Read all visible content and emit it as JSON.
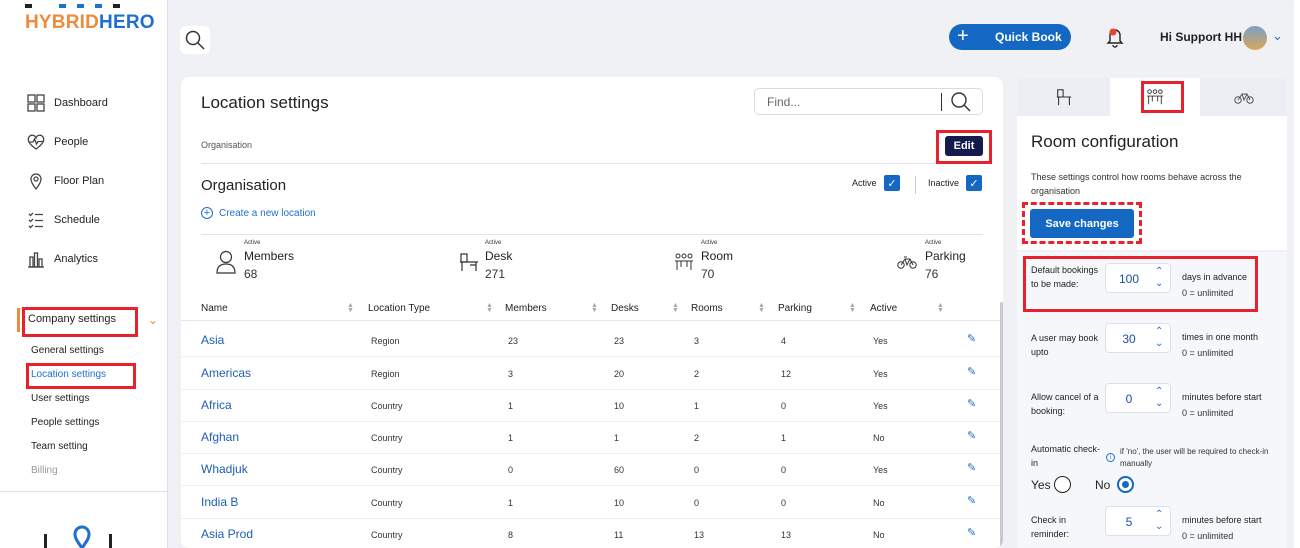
{
  "app": {
    "logo_part1": "HYBRID",
    "logo_part2": "HERO",
    "brand_orange": "#f08a3c",
    "brand_blue": "#1e6fd0"
  },
  "sidebar": {
    "items": [
      {
        "label": "Dashboard",
        "icon": "dashboard-icon"
      },
      {
        "label": "People",
        "icon": "heart-pulse-icon"
      },
      {
        "label": "Floor Plan",
        "icon": "map-pin-icon"
      },
      {
        "label": "Schedule",
        "icon": "schedule-list-icon"
      },
      {
        "label": "Analytics",
        "icon": "bar-chart-icon"
      }
    ],
    "company_settings": "Company settings",
    "sub_items": [
      "General settings",
      "Location settings",
      "User settings",
      "People settings",
      "Team setting",
      "Billing"
    ]
  },
  "header": {
    "quick_book": "Quick Book",
    "greeting": "Hi Support HH"
  },
  "main": {
    "title": "Location settings",
    "search_placeholder": "Find...",
    "breadcrumb": "Organisation",
    "edit_label": "Edit",
    "org_title": "Organisation",
    "active_label": "Active",
    "inactive_label": "Inactive",
    "create_location": "Create a new location",
    "stats": [
      {
        "caption": "Active",
        "name": "Members",
        "value": "68"
      },
      {
        "caption": "Active",
        "name": "Desk",
        "value": "271"
      },
      {
        "caption": "Active",
        "name": "Room",
        "value": "70"
      },
      {
        "caption": "Active",
        "name": "Parking",
        "value": "76"
      }
    ],
    "columns": [
      "Name",
      "Location Type",
      "Members",
      "Desks",
      "Rooms",
      "Parking",
      "Active"
    ],
    "rows": [
      {
        "name": "Asia",
        "type": "Region",
        "members": "23",
        "desks": "23",
        "rooms": "3",
        "parking": "4",
        "active": "Yes"
      },
      {
        "name": "Americas",
        "type": "Region",
        "members": "3",
        "desks": "20",
        "rooms": "2",
        "parking": "12",
        "active": "Yes"
      },
      {
        "name": "Africa",
        "type": "Country",
        "members": "1",
        "desks": "10",
        "rooms": "1",
        "parking": "0",
        "active": "Yes"
      },
      {
        "name": "Afghan",
        "type": "Country",
        "members": "1",
        "desks": "1",
        "rooms": "2",
        "parking": "1",
        "active": "No"
      },
      {
        "name": "Whadjuk",
        "type": "Country",
        "members": "0",
        "desks": "60",
        "rooms": "0",
        "parking": "0",
        "active": "Yes"
      },
      {
        "name": "India B",
        "type": "Country",
        "members": "1",
        "desks": "10",
        "rooms": "0",
        "parking": "0",
        "active": "No"
      },
      {
        "name": "Asia Prod",
        "type": "Country",
        "members": "8",
        "desks": "11",
        "rooms": "13",
        "parking": "13",
        "active": "No"
      }
    ]
  },
  "panel": {
    "title": "Room configuration",
    "description": "These settings control how rooms behave across the organisation",
    "save_label": "Save changes",
    "settings": [
      {
        "label": "Default bookings to be made:",
        "value": "100",
        "unit": "days in advance",
        "hint": "0 = unlimited"
      },
      {
        "label": "A user may book upto",
        "value": "30",
        "unit": "times in one month",
        "hint": "0 = unlimited"
      },
      {
        "label": "Allow cancel of a booking:",
        "value": "0",
        "unit": "minutes before start",
        "hint": "0 = unlimited"
      },
      {
        "label": "Check in reminder:",
        "value": "5",
        "unit": "minutes before start",
        "hint": "0 = unlimited"
      }
    ],
    "auto_checkin_label": "Automatic check-in",
    "auto_checkin_info": "if 'no', the user will be required to check-in manually",
    "yes_label": "Yes",
    "no_label": "No",
    "auto_checkin_value": "No"
  }
}
